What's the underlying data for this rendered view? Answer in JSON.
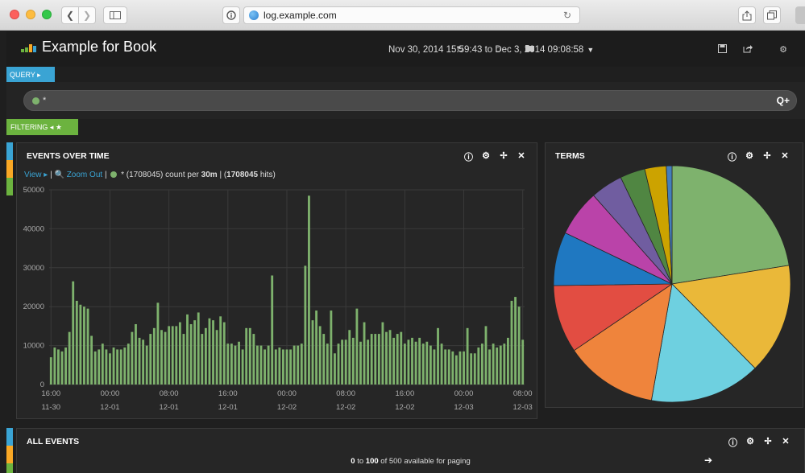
{
  "browser": {
    "url": "log.example.com"
  },
  "app": {
    "title": "Example for Book",
    "time_range": "Nov 30, 2014 15:59:43 to Dec 3, 2014 09:08:58",
    "nav_icons": [
      "refresh-icon",
      "home-icon",
      "folder-open-icon",
      "save-icon",
      "share-icon",
      "settings-icon"
    ]
  },
  "query": {
    "tab_label": "QUERY ▸",
    "value": "*",
    "actions": "Q+"
  },
  "filtering": {
    "tab_label": "FILTERING ◂ ★"
  },
  "events_over_time": {
    "title": "EVENTS OVER TIME",
    "view_link": "View ▸",
    "zoom_out_link": "Zoom Out",
    "series_label": "* (1708045)",
    "count_per_prefix": "count per",
    "interval": "30m",
    "hits_total": "1708045",
    "hits_suffix": "hits"
  },
  "terms": {
    "title": "TERMS"
  },
  "all_events": {
    "title": "ALL EVENTS",
    "paging_from": "0",
    "paging_to_word": "to",
    "paging_to": "100",
    "paging_suffix": "of 500 available for paging"
  },
  "panel_controls": [
    "info-icon",
    "gear-icon",
    "move-icon",
    "close-icon"
  ],
  "colors": {
    "bar": "#7eb26d",
    "query_tab": "#3aa4d4",
    "filter_tab": "#6cb33f"
  },
  "chart_data": [
    {
      "type": "bar",
      "title": "EVENTS OVER TIME",
      "ylim": [
        0,
        50000
      ],
      "y_ticks": [
        0,
        10000,
        20000,
        30000,
        40000,
        50000
      ],
      "x_tick_labels": [
        [
          "16:00",
          "11-30"
        ],
        [
          "00:00",
          "12-01"
        ],
        [
          "08:00",
          "12-01"
        ],
        [
          "16:00",
          "12-01"
        ],
        [
          "00:00",
          "12-02"
        ],
        [
          "08:00",
          "12-02"
        ],
        [
          "16:00",
          "12-02"
        ],
        [
          "00:00",
          "12-03"
        ],
        [
          "08:00",
          "12-03"
        ]
      ],
      "x_tick_index": [
        0,
        16,
        32,
        48,
        64,
        80,
        96,
        112,
        128
      ],
      "series": [
        {
          "color": "#7eb26d",
          "values": [
            7000,
            9500,
            9000,
            8500,
            9500,
            13500,
            26500,
            21500,
            20500,
            20000,
            19500,
            12500,
            8500,
            9000,
            10500,
            9000,
            8000,
            9500,
            9000,
            9000,
            9500,
            10500,
            13500,
            15500,
            12000,
            11500,
            10000,
            13000,
            14500,
            21000,
            14000,
            13500,
            15000,
            15000,
            15000,
            16000,
            13000,
            18000,
            15500,
            16500,
            18500,
            13000,
            14500,
            17000,
            16500,
            14000,
            17500,
            16000,
            10500,
            10500,
            10000,
            11000,
            9000,
            14500,
            14500,
            13000,
            10000,
            10000,
            9000,
            10000,
            28000,
            9000,
            9500,
            9000,
            9000,
            9000,
            10000,
            10000,
            10500,
            30500,
            48500,
            16500,
            19000,
            15000,
            13000,
            10500,
            19000,
            8000,
            10500,
            11500,
            11500,
            14000,
            12000,
            19500,
            11000,
            16000,
            11500,
            13000,
            13000,
            13000,
            16000,
            13500,
            14000,
            12000,
            13000,
            13500,
            10500,
            11500,
            12000,
            11000,
            12000,
            10500,
            11000,
            10000,
            9000,
            14500,
            10500,
            9000,
            9000,
            8500,
            7500,
            8500,
            8500,
            14500,
            8000,
            8000,
            9500,
            10500,
            15000,
            9000,
            10500,
            9500,
            10000,
            10500,
            12000,
            21500,
            22500,
            20000,
            11500
          ]
        }
      ]
    },
    {
      "type": "pie",
      "title": "TERMS",
      "slices": [
        {
          "value": 23,
          "color": "#7eb26d"
        },
        {
          "value": 15.5,
          "color": "#eab839"
        },
        {
          "value": 15.5,
          "color": "#6ed0e0"
        },
        {
          "value": 13,
          "color": "#ef843c"
        },
        {
          "value": 9.5,
          "color": "#e24d42"
        },
        {
          "value": 7.5,
          "color": "#1f78c1"
        },
        {
          "value": 6.5,
          "color": "#ba43a9"
        },
        {
          "value": 4.5,
          "color": "#705da0"
        },
        {
          "value": 3.5,
          "color": "#508642"
        },
        {
          "value": 3,
          "color": "#cca300"
        },
        {
          "value": 0.8,
          "color": "#447ebc"
        }
      ]
    }
  ]
}
